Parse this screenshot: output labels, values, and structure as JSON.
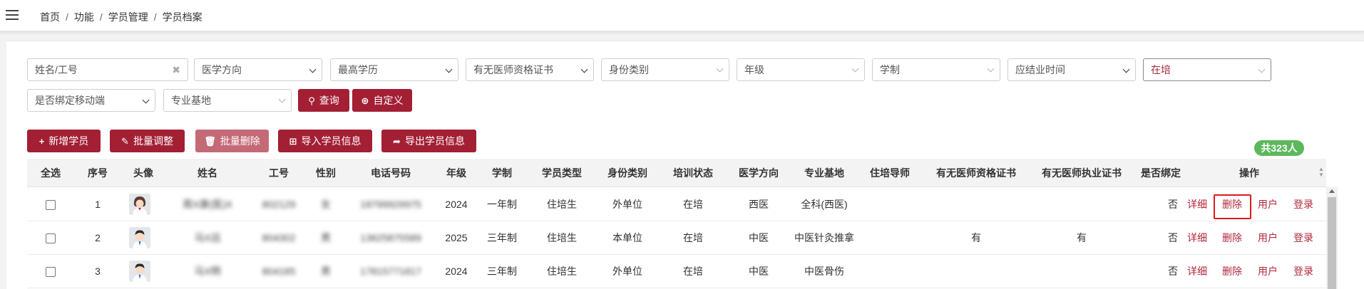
{
  "breadcrumb": [
    "首页",
    "功能",
    "学员管理",
    "学员档案"
  ],
  "filters": {
    "name_placeholder": "姓名/工号",
    "medical_direction": "医学方向",
    "education": "最高学历",
    "doctor_cert": "有无医师资格证书",
    "identity_type": "身份类别",
    "grade": "年级",
    "duration": "学制",
    "graduation_time": "应结业时间",
    "training_status": "在培",
    "mobile_binding": "是否绑定移动端",
    "base": "专业基地"
  },
  "buttons": {
    "query": "查询",
    "custom": "自定义",
    "add": "新增学员",
    "batch_adjust": "批量调整",
    "batch_delete": "批量删除",
    "import": "导入学员信息",
    "export": "导出学员信息"
  },
  "total": "共323人",
  "columns": [
    "全选",
    "序号",
    "头像",
    "姓名",
    "工号",
    "性别",
    "电话号码",
    "年级",
    "学制",
    "学员类型",
    "身份类别",
    "培训状态",
    "医学方向",
    "专业基地",
    "住培导师",
    "有无医师资格证书",
    "有无医师执业证书",
    "是否绑定",
    "操作"
  ],
  "rows": [
    {
      "no": "1",
      "name": "周X康(医)X",
      "id": "802129",
      "gender": "女",
      "phone": "18799929975",
      "grade": "2024",
      "duration": "一年制",
      "student_type": "住培生",
      "identity": "外单位",
      "status": "在培",
      "direction": "西医",
      "base": "全科(西医)",
      "mentor": "",
      "qual_cert": "",
      "prac_cert": "",
      "bound": "否"
    },
    {
      "no": "2",
      "name": "马X远",
      "id": "804302",
      "gender": "男",
      "phone": "13625875589",
      "grade": "2025",
      "duration": "三年制",
      "student_type": "住培生",
      "identity": "本单位",
      "status": "在培",
      "direction": "中医",
      "base": "中医针灸推拿",
      "mentor": "",
      "qual_cert": "有",
      "prac_cert": "有",
      "bound": "否"
    },
    {
      "no": "3",
      "name": "马X明",
      "id": "804185",
      "gender": "男",
      "phone": "17815771817",
      "grade": "2024",
      "duration": "三年制",
      "student_type": "住培生",
      "identity": "外单位",
      "status": "在培",
      "direction": "中医",
      "base": "中医骨伤",
      "mentor": "",
      "qual_cert": "",
      "prac_cert": "",
      "bound": "否"
    }
  ],
  "actions": {
    "detail": "详细",
    "delete": "删除",
    "user": "用户",
    "login": "登录"
  },
  "colors": {
    "primary": "#a31f34",
    "badge": "#5cb85c",
    "highlight": "#e0191b"
  }
}
